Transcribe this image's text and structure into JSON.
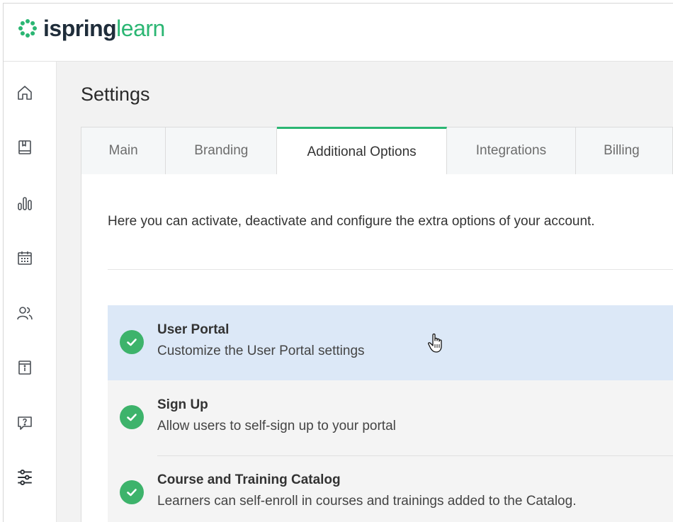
{
  "brand": {
    "logo_part1": "ispring",
    "logo_part2": "learn",
    "green": "#2bb673",
    "dark": "#1f2d3a"
  },
  "sidebar": {
    "items": [
      {
        "icon": "home-icon"
      },
      {
        "icon": "book-icon"
      },
      {
        "icon": "bar-chart-icon"
      },
      {
        "icon": "calendar-icon"
      },
      {
        "icon": "users-icon"
      },
      {
        "icon": "info-box-icon"
      },
      {
        "icon": "help-icon"
      },
      {
        "icon": "settings-sliders-icon"
      }
    ]
  },
  "page": {
    "title": "Settings"
  },
  "tabs": [
    {
      "label": "Main",
      "active": false
    },
    {
      "label": "Branding",
      "active": false
    },
    {
      "label": "Additional Options",
      "active": true
    },
    {
      "label": "Integrations",
      "active": false
    },
    {
      "label": "Billing",
      "active": false
    }
  ],
  "panel": {
    "intro": "Here you can activate, deactivate and configure the extra options of your account.",
    "options": [
      {
        "title": "User Portal",
        "description": "Customize the User Portal settings",
        "enabled": true,
        "hovered": true
      },
      {
        "title": "Sign Up",
        "description": "Allow users to self-sign up to your portal",
        "enabled": true,
        "hovered": false
      },
      {
        "title": "Course and Training Catalog",
        "description": "Learners can self-enroll in courses and trainings added to the Catalog.",
        "enabled": true,
        "hovered": false
      }
    ]
  }
}
